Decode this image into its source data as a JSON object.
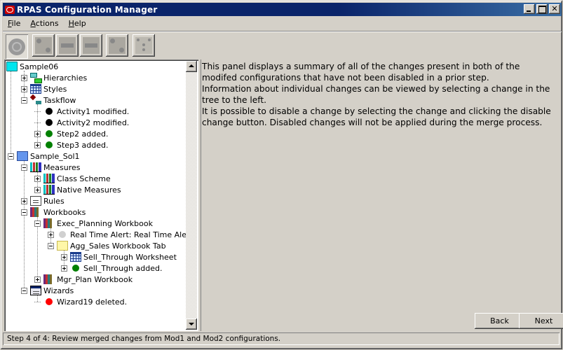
{
  "window": {
    "title": "RPAS Configuration Manager",
    "controls": {
      "minimize": "_",
      "maximize": "□",
      "close": "✕"
    }
  },
  "menu": [
    {
      "label": "File",
      "mnemonic": "F",
      "rest": "ile"
    },
    {
      "label": "Actions",
      "mnemonic": "A",
      "rest": "ctions"
    },
    {
      "label": "Help",
      "mnemonic": "H",
      "rest": "elp"
    }
  ],
  "toolbar": [
    {
      "name": "select-tool",
      "icon": "circle-target-icon",
      "pressed": true
    },
    {
      "name": "connect-tool",
      "icon": "connect-nodes-icon",
      "pressed": false
    },
    {
      "name": "merge-right-tool",
      "icon": "arrow-right-icon",
      "pressed": false
    },
    {
      "name": "merge-left-tool",
      "icon": "arrow-left-icon",
      "pressed": false
    },
    {
      "name": "link-tool",
      "icon": "link-nodes-icon",
      "pressed": false
    },
    {
      "name": "layout-tool",
      "icon": "grid-layout-icon",
      "pressed": false
    }
  ],
  "tree": {
    "nodes": [
      {
        "label": "Sample06",
        "level": 0,
        "icon": "folder-cyan",
        "expander": "none"
      },
      {
        "label": "Hierarchies",
        "level": 1,
        "icon": "hierarchy",
        "expander": "plus"
      },
      {
        "label": "Styles",
        "level": 1,
        "icon": "grid",
        "expander": "plus"
      },
      {
        "label": "Taskflow",
        "level": 1,
        "icon": "taskflow",
        "expander": "minus"
      },
      {
        "label": "Activity1 modified.",
        "level": 2,
        "icon": "bullet-black",
        "expander": "none"
      },
      {
        "label": "Activity2 modified.",
        "level": 2,
        "icon": "bullet-black",
        "expander": "none"
      },
      {
        "label": "Step2 added.",
        "level": 2,
        "icon": "bullet-green",
        "expander": "plus"
      },
      {
        "label": "Step3 added.",
        "level": 2,
        "icon": "bullet-green",
        "expander": "plus"
      },
      {
        "label": "Sample_Sol1",
        "level": 0,
        "icon": "folder-blue",
        "expander": "minus"
      },
      {
        "label": "Measures",
        "level": 1,
        "icon": "bars",
        "expander": "minus"
      },
      {
        "label": "Class Scheme",
        "level": 2,
        "icon": "bars-cyan",
        "expander": "plus"
      },
      {
        "label": "Native Measures",
        "level": 2,
        "icon": "bars-cyan",
        "expander": "plus"
      },
      {
        "label": "Rules",
        "level": 1,
        "icon": "document",
        "expander": "plus"
      },
      {
        "label": "Workbooks",
        "level": 1,
        "icon": "books",
        "expander": "minus"
      },
      {
        "label": "Exec_Planning Workbook",
        "level": 2,
        "icon": "books",
        "expander": "minus"
      },
      {
        "label": "Real Time Alert: Real Time Alert",
        "level": 3,
        "icon": "bullet-grey",
        "expander": "plus"
      },
      {
        "label": "Agg_Sales Workbook Tab",
        "level": 3,
        "icon": "folder-yellow",
        "expander": "minus"
      },
      {
        "label": "Sell_Through Worksheet",
        "level": 4,
        "icon": "grid",
        "expander": "plus"
      },
      {
        "label": "Sell_Through added.",
        "level": 4,
        "icon": "bullet-green",
        "expander": "plus"
      },
      {
        "label": "Mgr_Plan Workbook",
        "level": 2,
        "icon": "books",
        "expander": "plus"
      },
      {
        "label": "Wizards",
        "level": 1,
        "icon": "wizard",
        "expander": "minus"
      },
      {
        "label": "Wizard19 deleted.",
        "level": 2,
        "icon": "bullet-red",
        "expander": "none"
      }
    ]
  },
  "info": {
    "paragraphs": [
      "This panel displays a summary of all of the changes present in both of the modifed configurations that have not been disabled in a prior step.",
      "Information about individual changes can be viewed by selecting a change in the tree to the left.",
      "It is possible to disable a change by selecting the change and clicking the disable change button. Disabled changes will not be applied during the merge process."
    ]
  },
  "buttons": {
    "back": "Back",
    "next": "Next"
  },
  "status": "Step 4 of 4: Review merged changes from Mod1 and Mod2 configurations.",
  "colors": {
    "titlebar": "#0a246a",
    "bullet-black": "#000000",
    "bullet-green": "#008000",
    "bullet-red": "#ff0000",
    "bullet-grey": "#d0d0d0"
  }
}
